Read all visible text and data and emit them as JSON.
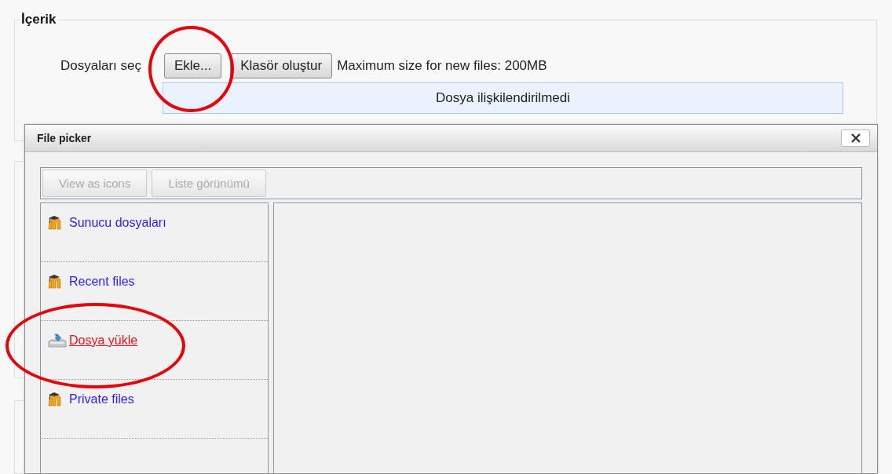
{
  "section": {
    "legend": "İçerik",
    "file_field": {
      "label": "Dosyaları seç",
      "buttons": [
        "Ekle...",
        "Klasör oluştur"
      ],
      "max_size": "Maximum size for new files: 200MB",
      "drop_area": "Dosya ilişkilendirilmedi"
    }
  },
  "file_picker": {
    "title": "File picker",
    "view_buttons": [
      {
        "label": "View as icons",
        "disabled": true
      },
      {
        "label": "Liste görünümü",
        "disabled": true
      }
    ],
    "repositories": [
      {
        "label": "Sunucu dosyaları",
        "kind": "moodle",
        "selected": false
      },
      {
        "label": "Recent files",
        "kind": "moodle",
        "selected": false
      },
      {
        "label": "Dosya yükle",
        "kind": "upload",
        "selected": true
      },
      {
        "label": "Private files",
        "kind": "moodle",
        "selected": false
      }
    ]
  }
}
